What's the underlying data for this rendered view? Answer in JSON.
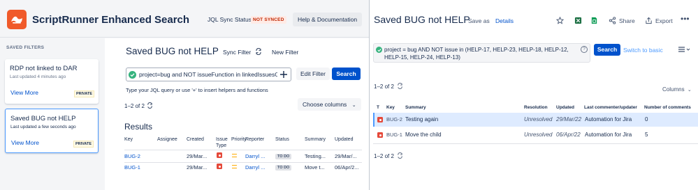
{
  "app": {
    "title": "ScriptRunner Enhanced Search",
    "sync_label": "JQL Sync Status",
    "sync_badge": "NOT SYNCED",
    "help_label": "Help & Documentation",
    "brand_color": "#f05a2a"
  },
  "sidebar": {
    "title": "SAVED FILTERS",
    "filters": [
      {
        "name": "RDP not linked to DAR",
        "updated": "Last updated 4 minutes ago",
        "view": "View More",
        "badge": "PRIVATE"
      },
      {
        "name": "Saved BUG not HELP",
        "updated": "Last updated a few seconds ago",
        "view": "View More",
        "badge": "PRIVATE"
      }
    ]
  },
  "main": {
    "title": "Saved BUG not HELP",
    "sync_filter": "Sync Filter",
    "new_filter": "New Filter",
    "jql": "project=bug and NOT issueFunction in linkedIssuesOf(\"",
    "edit_filter": "Edit Filter",
    "search": "Search",
    "hint": "Type your JQL query or use '+' to insert helpers and functions",
    "count": "1–2 of 2",
    "choose_columns": "Choose columns",
    "results_title": "Results",
    "columns": [
      "Key",
      "Assignee",
      "Created",
      "Issue Type",
      "Priority",
      "Reporter",
      "Status",
      "Summary",
      "Updated"
    ],
    "rows": [
      {
        "key": "BUG-2",
        "assignee": "",
        "created": "29/Mar...",
        "reporter": "Darryl ...",
        "status": "TO DO",
        "summary": "Testing...",
        "updated": "29/Mar/..."
      },
      {
        "key": "BUG-1",
        "assignee": "",
        "created": "29/Mar...",
        "reporter": "Darryl ...",
        "status": "TO DO",
        "summary": "Move t...",
        "updated": "06/Apr/2..."
      }
    ]
  },
  "jira": {
    "title": "Saved BUG not HELP",
    "save_as": "Save as",
    "details": "Details",
    "share": "Share",
    "export": "Export",
    "jql": "project = bug AND NOT issue in (HELP-17, HELP-23, HELP-18, HELP-12, HELP-15, HELP-24, HELP-13)",
    "search": "Search",
    "switch_basic": "Switch to basic",
    "count": "1–2 of 2",
    "columns_btn": "Columns",
    "columns": [
      "T",
      "Key",
      "Summary",
      "Resolution",
      "Updated",
      "Last commenter/updater",
      "Number of comments"
    ],
    "rows": [
      {
        "key": "BUG-2",
        "summary": "Testing again",
        "resolution": "Unresolved",
        "updated": "29/Mar/22",
        "last": "Automation for Jira",
        "comments": "0"
      },
      {
        "key": "BUG-1",
        "summary": "Move the child",
        "resolution": "Unresolved",
        "updated": "06/Apr/22",
        "last": "Automation for Jira",
        "comments": "5"
      }
    ],
    "count_bottom": "1–2 of 2"
  }
}
